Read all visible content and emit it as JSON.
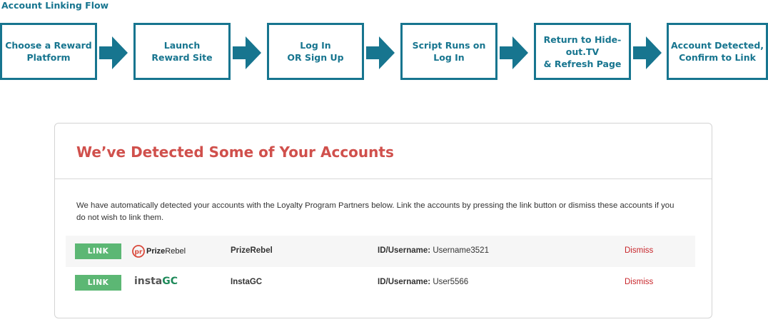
{
  "flow": {
    "title": "Account Linking Flow",
    "steps": [
      "Choose a Reward\nPlatform",
      "Launch\nReward Site",
      "Log In\nOR Sign Up",
      "Script Runs on\nLog In",
      "Return to Hide-\nout.TV\n& Refresh Page",
      "Account Detected,\nConfirm to Link"
    ],
    "color": "#17758f"
  },
  "card": {
    "title": "We’ve Detected Some of Your Accounts",
    "description": "We have automatically detected your accounts with the Loyalty Program Partners below. Link the accounts by pressing the link button or dismiss these accounts if you do not wish to link them.",
    "title_color": "#d0504c",
    "rows": [
      {
        "button": "LINK",
        "logo_icon": "prizerebel-logo",
        "logo_text_a": "Prize",
        "logo_text_b": "Rebel",
        "partner": "PrizeRebel",
        "id_label": "ID/Username:",
        "id_value": "Username3521",
        "dismiss": "Dismiss"
      },
      {
        "button": "LINK",
        "logo_icon": "instagc-logo",
        "logo_text_a": "insta",
        "logo_text_b": "GC",
        "partner": "InstaGC",
        "id_label": "ID/Username:",
        "id_value": "User5566",
        "dismiss": "Dismiss"
      }
    ],
    "button_color": "#5cb774",
    "dismiss_color": "#c8262b"
  }
}
